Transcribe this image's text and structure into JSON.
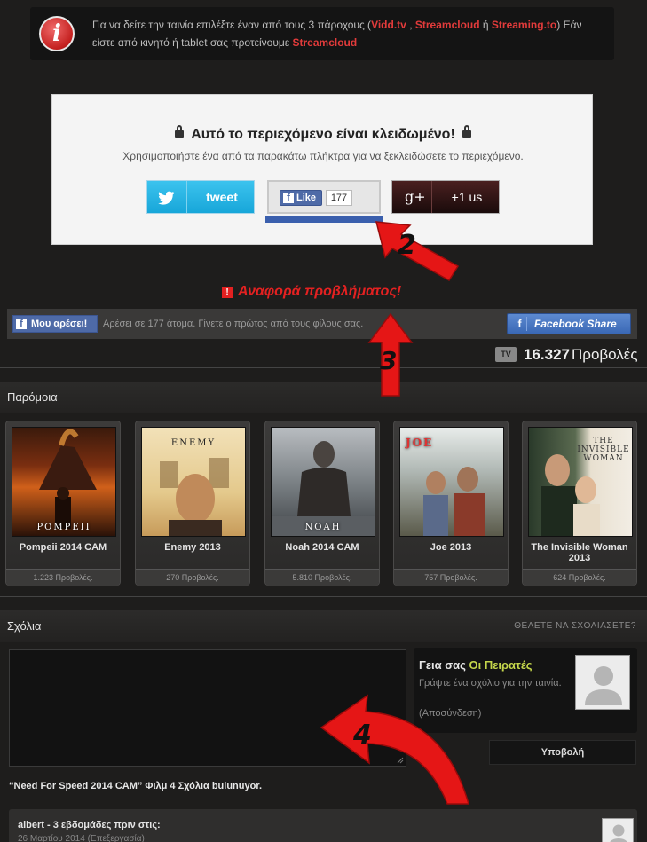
{
  "notice": {
    "icon": "info-icon",
    "icon_glyph": "i",
    "text_before": "Για να δείτε την ταινία επιλέξτε έναν από τους 3 πάροχους (",
    "provider_1": "Vidd.tv",
    "sep_1": " , ",
    "provider_2": "Streamcloud",
    "sep_2": " ή ",
    "provider_3": "Streaming.to",
    "text_mid": ") Εάν είστε από κινητό ή tablet σας προτείνουμε ",
    "provider_mobile": "Streamcloud"
  },
  "locker": {
    "title": "Αυτό το περιεχόμενο είναι κλειδωμένο!",
    "subtitle": "Χρησιμοποιήστε ένα από τα παρακάτω πλήκτρα για να ξεκλειδώσετε το περιεχόμενο.",
    "tweet_label": "tweet",
    "fb_like_label": "Like",
    "fb_like_count": "177",
    "gplus_glyph": "g+",
    "gplus_label": "+1 us"
  },
  "report": {
    "glyph": "!",
    "label": "Αναφορά προβλήματος!"
  },
  "facebook_bar": {
    "like_label": "Μου αρέσει!",
    "like_text": "Αρέσει σε 177 άτομα. Γίνετε ο πρώτος από τους φίλους σας.",
    "share_label": "Facebook Share"
  },
  "views": {
    "badge": "TV",
    "count": "16.327",
    "label": "Προβολές"
  },
  "similar": {
    "title": "Παρόμοια",
    "movies": [
      {
        "name": "Pompeii 2014 CAM",
        "views": "1.223 Προβολές.",
        "poster_title": "POMPEII"
      },
      {
        "name": "Enemy 2013",
        "views": "270 Προβολές.",
        "poster_title": "ENEMY"
      },
      {
        "name": "Noah 2014 CAM",
        "views": "5.810 Προβολές.",
        "poster_title": "NOAH"
      },
      {
        "name": "Joe 2013",
        "views": "757 Προβολές.",
        "poster_title": "JOE"
      },
      {
        "name": "The Invisible Woman 2013",
        "views": "624 Προβολές.",
        "poster_title": "THE INVISIBLE WOMAN"
      }
    ]
  },
  "comments": {
    "title": "Σχόλια",
    "link": "ΘΕΛΕΤΕ ΝΑ ΣΧΟΛΙΑΣΕΤΕ?",
    "greeting": "Γεια σας",
    "user_name": "Οι Πειρατές",
    "hint": "Γράψτε ένα σχόλιο για την ταινία.",
    "logout": "(Αποσύνδεση)",
    "submit": "Υποβολή",
    "count_text": "“Need For Speed 2014 CAM” Φιλμ 4 Σχόλια bulunuyor.",
    "items": [
      {
        "author": "albert - 3 εβδομάδες πριν στις:",
        "date": "26 Μαρτίου 2014 (Επεξεργασία)"
      }
    ]
  },
  "annotations": [
    "2",
    "3",
    "4"
  ],
  "colors": {
    "background": "#1e1d1c",
    "accent_red": "#e42121",
    "fb_blue": "#4e6aa7",
    "twitter_blue": "#1ea9dc",
    "username_green": "#c4d64b"
  }
}
